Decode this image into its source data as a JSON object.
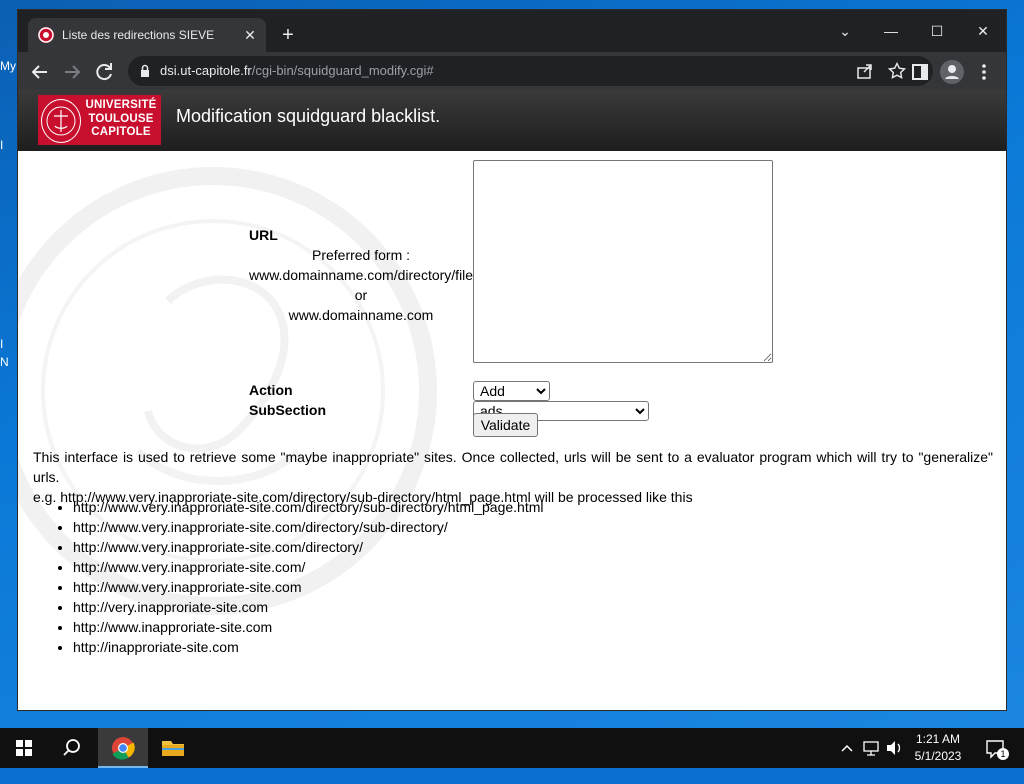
{
  "desktop": {
    "fragments": [
      "My",
      "I",
      "I",
      "N"
    ]
  },
  "browser": {
    "tab_title": "Liste des redirections SIEVE",
    "tab_close": "✕",
    "new_tab": "+",
    "window_controls": {
      "tab_search": "⌄",
      "minimize": "—",
      "maximize": "☐",
      "close": "✕"
    },
    "url_host": "dsi.ut-capitole.fr",
    "url_path": "/cgi-bin/squidguard_modify.cgi#"
  },
  "page": {
    "logo_text": [
      "UNIVERSITÉ",
      "TOULOUSE",
      "CAPITOLE"
    ],
    "banner_title": "Modification squidguard blacklist.",
    "form": {
      "url_label": "URL",
      "preferred_form": "Preferred form :",
      "example_path": "www.domainname.com/directory/file",
      "or": "or",
      "example_domain": "www.domainname.com",
      "url_value": "",
      "action_label": "Action",
      "action_selected": "Add",
      "subsection_label": "SubSection",
      "subsection_selected": "ads",
      "validate_label": "Validate"
    },
    "description": "This interface is used to retrieve some \"maybe inappropriate\" sites. Once collected, urls will be sent to a evaluator program which will try to \"generalize\" urls.",
    "example_intro": "e.g. http://www.very.inapproriate-site.com/directory/sub-directory/html_page.html will be processed like this",
    "examples": [
      "http://www.very.inapproriate-site.com/directory/sub-directory/html_page.html",
      "http://www.very.inapproriate-site.com/directory/sub-directory/",
      "http://www.very.inapproriate-site.com/directory/",
      "http://www.very.inapproriate-site.com/",
      "http://www.very.inapproriate-site.com",
      "http://very.inapproriate-site.com",
      "http://www.inapproriate-site.com",
      "http://inapproriate-site.com"
    ]
  },
  "taskbar": {
    "time": "1:21 AM",
    "date": "5/1/2023",
    "notification_count": "1"
  },
  "colors": {
    "brand_red": "#c8102e",
    "chrome_dark": "#202124",
    "chrome_toolbar": "#35363a",
    "banner_dark": "#2a2a2a",
    "desktop_blue": "#0a6fd0"
  }
}
